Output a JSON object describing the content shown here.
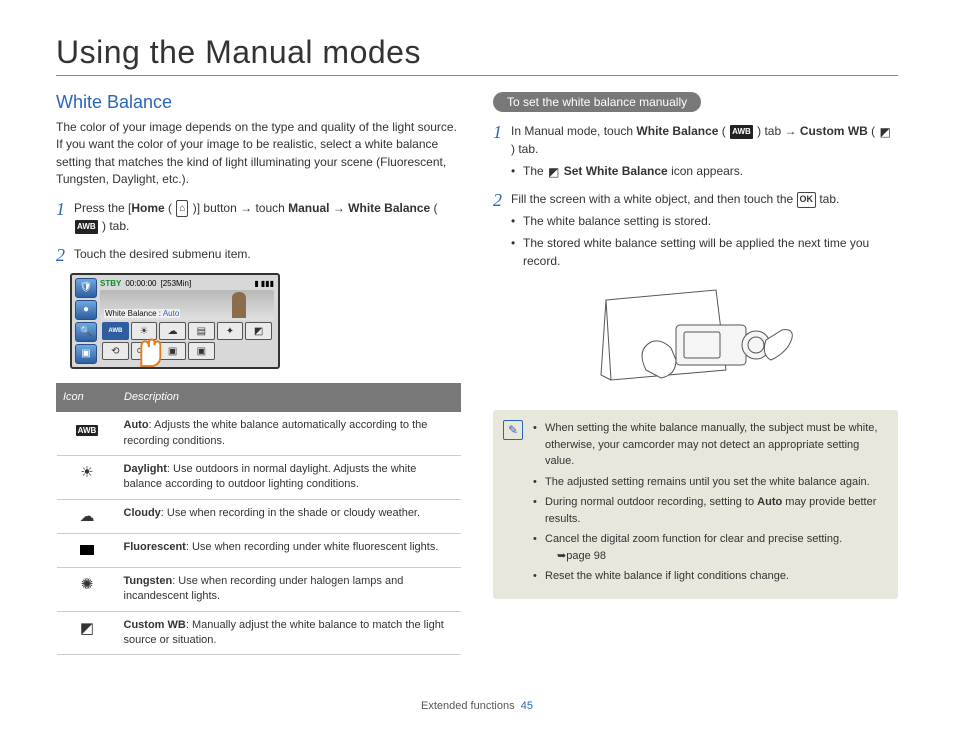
{
  "page_title": "Using the Manual modes",
  "section_title": "White Balance",
  "intro": "The color of your image depends on the type and quality of the light source. If you want the color of your image to be realistic, select a white balance setting that matches the kind of light illuminating your scene (Fluorescent, Tungsten, Daylight, etc.).",
  "left_steps": {
    "s1_a": "Press the [",
    "s1_home": "Home",
    "s1_b": " ( ",
    "s1_c": " )] button → touch ",
    "s1_manual": "Manual",
    "s1_d": " → ",
    "s1_wb": "White Balance",
    "s1_e": " ( ",
    "s1_f": " ) tab.",
    "s2": "Touch the desired submenu item."
  },
  "screenshot": {
    "stby": "STBY",
    "time": "00:00:00",
    "remain": "[253Min]",
    "wb_label": "White Balance : ",
    "wb_value": "Auto"
  },
  "table": {
    "head_icon": "Icon",
    "head_desc": "Description",
    "rows": [
      {
        "icon": "awb",
        "name": "Auto",
        "desc": ": Adjusts the white balance automatically according to the recording conditions."
      },
      {
        "icon": "sun",
        "name": "Daylight",
        "desc": ": Use outdoors in normal daylight. Adjusts the white balance according to outdoor lighting conditions."
      },
      {
        "icon": "cloud",
        "name": "Cloudy",
        "desc": ": Use when recording in the shade or cloudy weather."
      },
      {
        "icon": "fluor",
        "name": "Fluorescent",
        "desc": ": Use when recording under white fluorescent lights."
      },
      {
        "icon": "tung",
        "name": "Tungsten",
        "desc": ": Use when recording under halogen lamps and incandescent lights."
      },
      {
        "icon": "cwb",
        "name": "Custom WB",
        "desc": ": Manually adjust the white balance to match the light source or situation."
      }
    ]
  },
  "right_pill": "To set the white balance manually",
  "right_steps": {
    "r1_a": "In Manual mode, touch ",
    "r1_wb": "White Balance",
    "r1_b": " ( ",
    "r1_c": " ) tab → ",
    "r1_cwb": "Custom WB",
    "r1_d": " ( ",
    "r1_e": " ) tab.",
    "r1_sub_a": "The ",
    "r1_sub_b": "Set White Balance",
    "r1_sub_c": " icon appears.",
    "r2_a": "Fill the screen with a white object, and then touch the ",
    "r2_b": " tab.",
    "r2_sub1": "The white balance setting is stored.",
    "r2_sub2": "The stored white balance setting will be applied the next time you record."
  },
  "notes": [
    "When setting the white balance manually, the subject must be white, otherwise, your camcorder may not detect an appropriate setting value.",
    "The adjusted setting remains until you set the white balance again.",
    "During normal outdoor recording, setting to Auto may provide better results.",
    "Cancel the digital zoom function for clear and precise setting.",
    "Reset the white balance if light conditions change."
  ],
  "note_pageref": "➥page 98",
  "footer_label": "Extended functions",
  "footer_page": "45"
}
